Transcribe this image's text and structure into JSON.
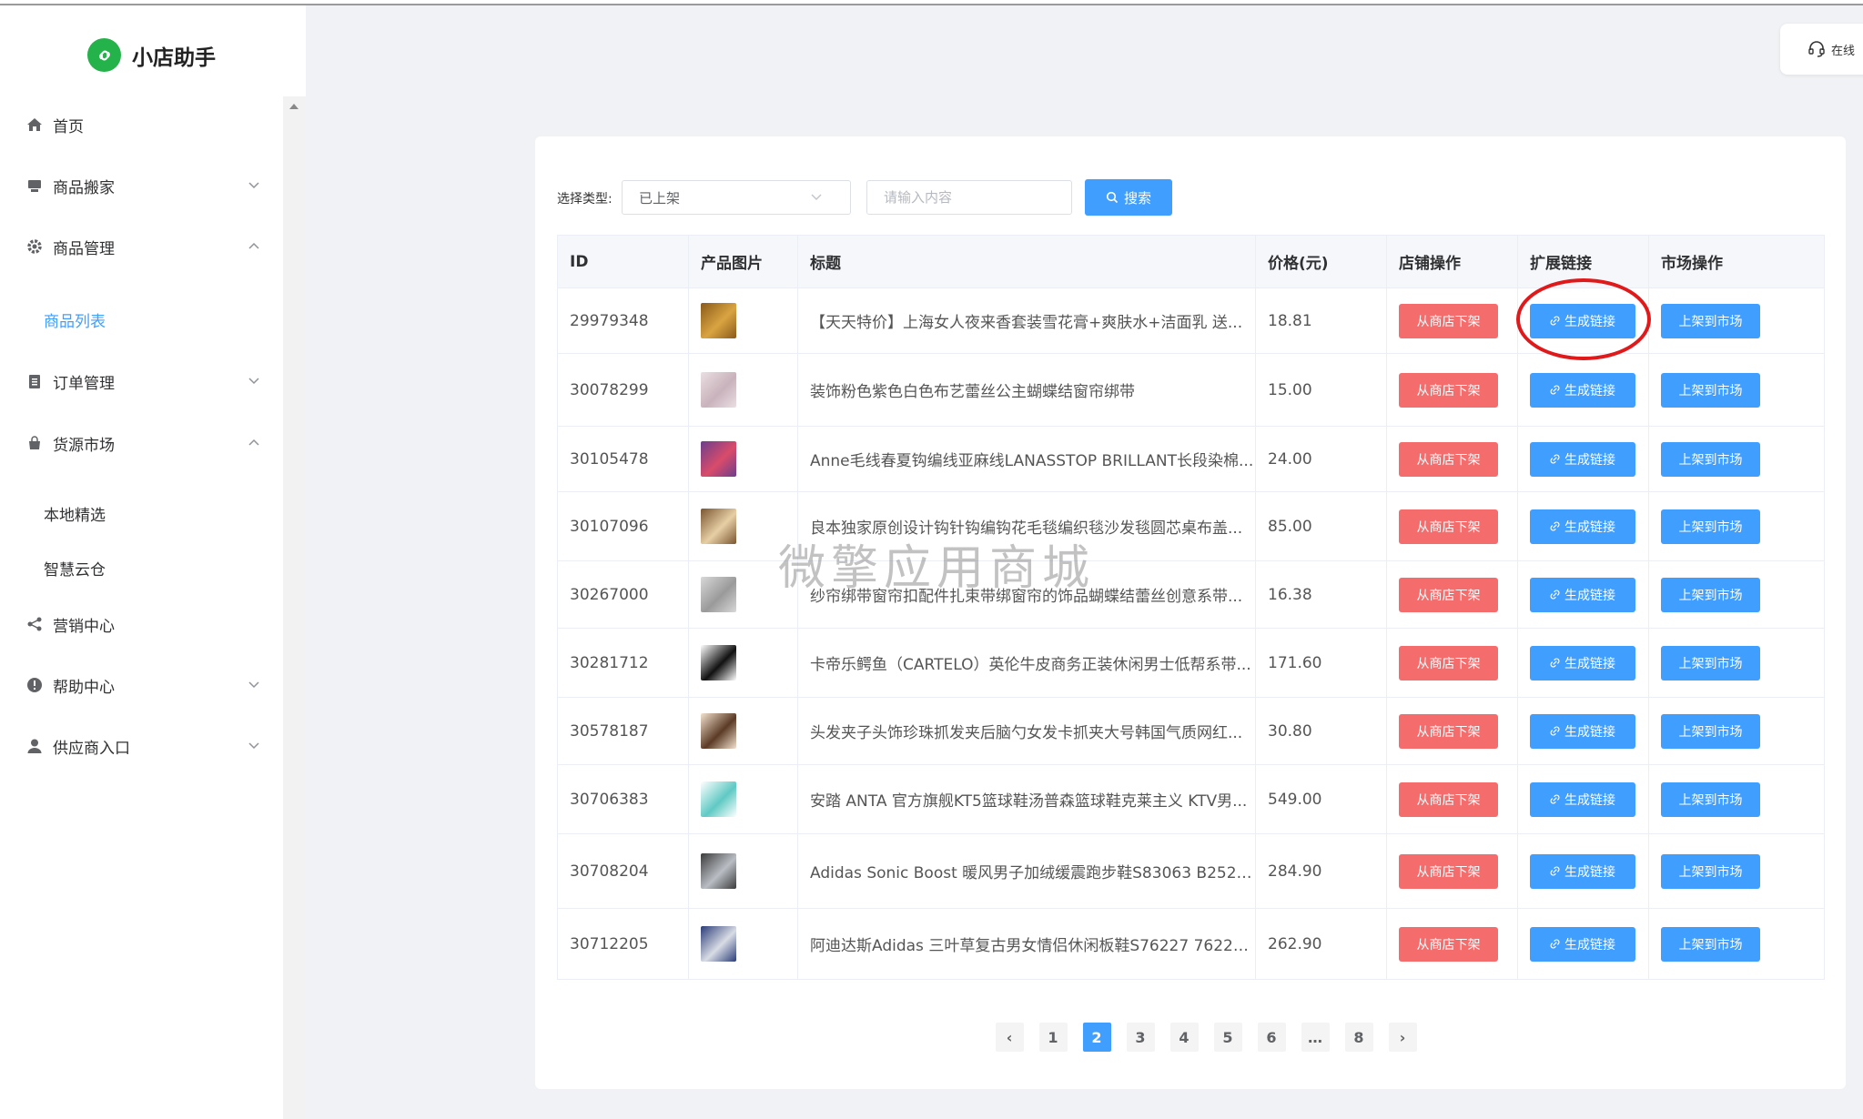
{
  "app": {
    "name": "小店助手",
    "brand_color": "#24b24a"
  },
  "sidebar": {
    "items": [
      {
        "label": "首页",
        "icon": "home-icon"
      },
      {
        "label": "商品搬家",
        "icon": "store-icon",
        "caret": "down"
      },
      {
        "label": "商品管理",
        "icon": "gear-icon",
        "caret": "up"
      },
      {
        "label": "订单管理",
        "icon": "clipboard-icon",
        "caret": "down"
      },
      {
        "label": "货源市场",
        "icon": "bag-icon",
        "caret": "up"
      },
      {
        "label": "营销中心",
        "icon": "share-icon"
      },
      {
        "label": "帮助中心",
        "icon": "info-icon",
        "caret": "down"
      },
      {
        "label": "供应商入口",
        "icon": "user-icon",
        "caret": "down"
      }
    ],
    "sub_goods": {
      "label": "商品列表",
      "active": true
    },
    "sub_market": [
      {
        "label": "本地精选"
      },
      {
        "label": "智慧云仓"
      }
    ]
  },
  "help": {
    "label": "在线"
  },
  "filter": {
    "type_label": "选择类型:",
    "type_value": "已上架",
    "search_placeholder": "请输入内容",
    "search_button": "搜索"
  },
  "table": {
    "columns": [
      "ID",
      "产品图片",
      "标题",
      "价格(元)",
      "店铺操作",
      "扩展链接",
      "市场操作"
    ],
    "actions": {
      "shop": "从商店下架",
      "link": "生成链接",
      "market": "上架到市场"
    },
    "rows": [
      {
        "id": "29979348",
        "title": "【天天特价】上海女人夜来香套装雪花膏+爽肤水+洁面乳 送...",
        "price": "18.81",
        "thumb": "cosmetics-thumb"
      },
      {
        "id": "30078299",
        "title": "装饰粉色紫色白色布艺蕾丝公主蝴蝶结窗帘绑带",
        "price": "15.00",
        "thumb": "ribbon-thumb"
      },
      {
        "id": "30105478",
        "title": "Anne毛线春夏钩编线亚麻线LANASSTOP BRILLANT长段染棉...",
        "price": "24.00",
        "thumb": "yarn-thumb"
      },
      {
        "id": "30107096",
        "title": "良本独家原创设计钩针钩编钩花毛毯编织毯沙发毯圆芯桌布盖...",
        "price": "85.00",
        "thumb": "blanket-thumb"
      },
      {
        "id": "30267000",
        "title": "纱帘绑带窗帘扣配件扎束带绑窗帘的饰品蝴蝶结蕾丝创意系带...",
        "price": "16.38",
        "thumb": "curtain-thumb"
      },
      {
        "id": "30281712",
        "title": "卡帝乐鳄鱼（CARTELO）英伦牛皮商务正装休闲男士低帮系带...",
        "price": "171.60",
        "thumb": "shoe-thumb"
      },
      {
        "id": "30578187",
        "title": "头发夹子头饰珍珠抓发夹后脑勺女发卡抓夹大号韩国气质网红...",
        "price": "30.80",
        "thumb": "hairclip-thumb"
      },
      {
        "id": "30706383",
        "title": "安踏 ANTA 官方旗舰KT5篮球鞋汤普森篮球鞋克莱主义 KTV男...",
        "price": "549.00",
        "thumb": "sneaker-thumb"
      },
      {
        "id": "30708204",
        "title": "Adidas Sonic Boost 暖风男子加绒缓震跑步鞋S83063 B2525...",
        "price": "284.90",
        "thumb": "runner-thumb"
      },
      {
        "id": "30712205",
        "title": "阿迪达斯Adidas 三叶草复古男女情侣休闲板鞋S76227 76228...",
        "price": "262.90",
        "thumb": "adidas-thumb"
      }
    ]
  },
  "pagination": {
    "prev": "‹",
    "next": "›",
    "pages": [
      "1",
      "2",
      "3",
      "4",
      "5",
      "6",
      "…",
      "8"
    ],
    "current": "2"
  },
  "watermark": "微擎应用商城",
  "colors": {
    "primary": "#409eff",
    "danger": "#f56c6c",
    "annotation": "#e0191b"
  }
}
